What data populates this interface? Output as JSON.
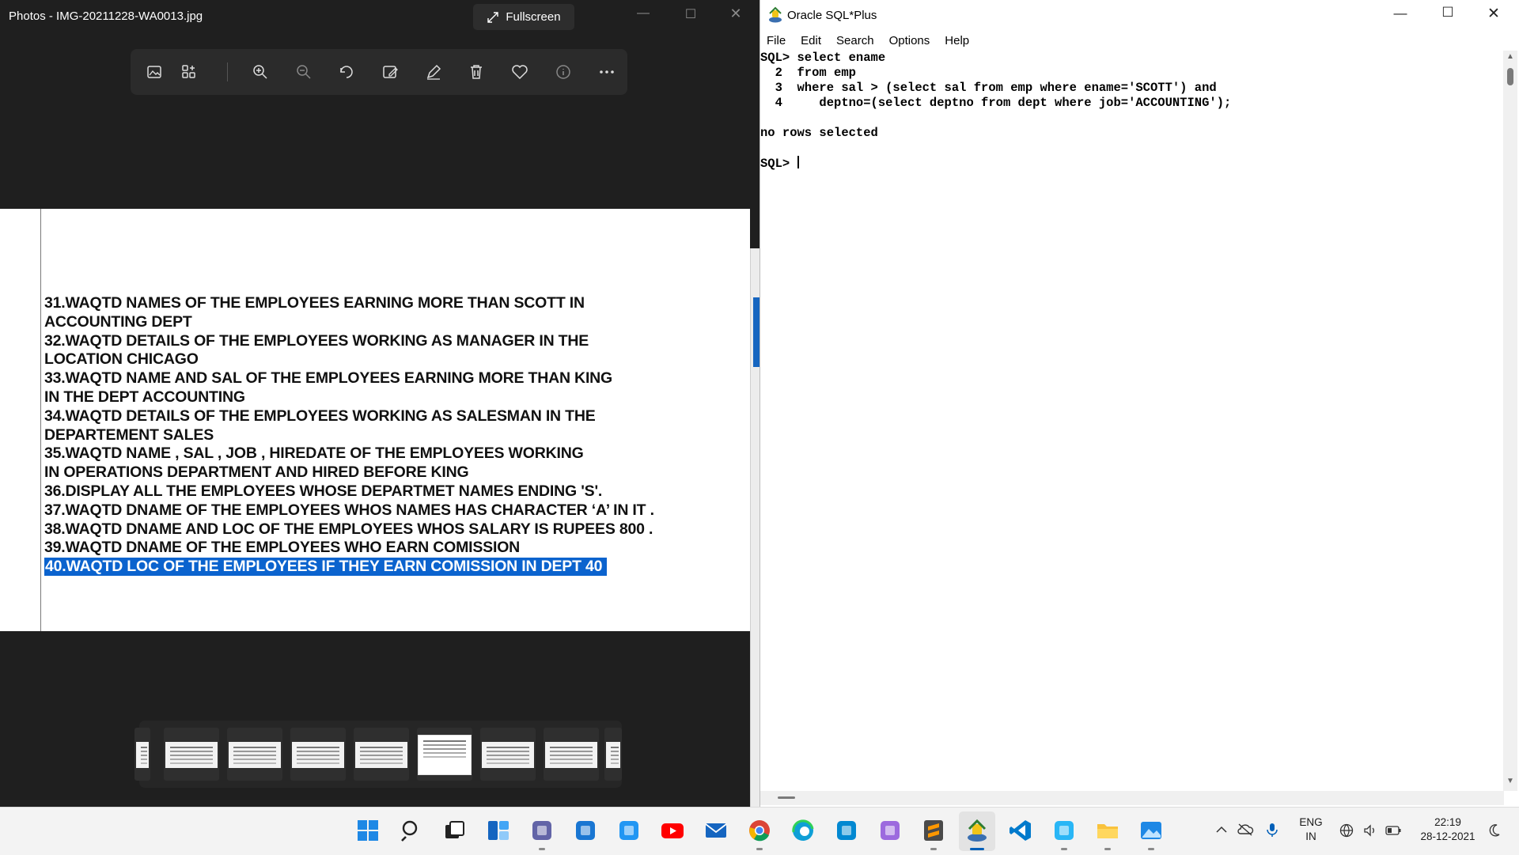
{
  "photos": {
    "title": "Photos - IMG-20211228-WA0013.jpg",
    "fullscreen_label": "Fullscreen",
    "toolbar_icons": [
      "image-icon",
      "album-icon",
      "zoom-in-icon",
      "zoom-out-icon",
      "rotate-icon",
      "edit-image-icon",
      "draw-icon",
      "delete-icon",
      "favorite-icon",
      "info-icon",
      "more-icon"
    ],
    "document_lines": [
      "31.WAQTD NAMES OF THE EMPLOYEES EARNING MORE THAN SCOTT IN",
      "ACCOUNTING DEPT",
      "32.WAQTD DETAILS OF THE EMPLOYEES WORKING AS MANAGER IN THE",
      "LOCATION CHICAGO",
      "33.WAQTD NAME AND SAL OF THE EMPLOYEES EARNING MORE THAN KING",
      " IN THE DEPT ACCOUNTING",
      "34.WAQTD DETAILS OF THE EMPLOYEES WORKING AS SALESMAN IN THE",
      "DEPARTEMENT SALES",
      "35.WAQTD NAME , SAL , JOB , HIREDATE OF THE EMPLOYEES WORKING",
      " IN OPERATIONS DEPARTMENT AND HIRED BEFORE KING",
      "36.DISPLAY ALL THE EMPLOYEES WHOSE DEPARTMET NAMES ENDING 'S'.",
      "37.WAQTD DNAME OF THE EMPLOYEES WHOS NAMES HAS CHARACTER ‘A’ IN IT .",
      "38.WAQTD DNAME AND LOC OF THE EMPLOYEES WHOS SALARY IS RUPEES 800 .",
      "39.WAQTD DNAME OF THE EMPLOYEES WHO EARN COMISSION",
      "40.WAQTD LOC OF THE EMPLOYEES IF THEY EARN COMISSION IN DEPT 40"
    ],
    "highlighted_line_index": 14
  },
  "sqlplus": {
    "title": "Oracle SQL*Plus",
    "menu": [
      "File",
      "Edit",
      "Search",
      "Options",
      "Help"
    ],
    "console_lines": [
      "SQL> select ename",
      "  2  from emp",
      "  3  where sal > (select sal from emp where ename='SCOTT') and",
      "  4     deptno=(select deptno from dept where job='ACCOUNTING');",
      "",
      "no rows selected",
      "",
      "SQL> "
    ]
  },
  "taskbar": {
    "apps": [
      "start-icon",
      "search-icon",
      "task-view-icon",
      "widgets-icon",
      "teams-chat-icon",
      "store-icon",
      "phone-icon",
      "youtube-icon",
      "mail-icon",
      "chrome-icon",
      "edge-icon",
      "remote-desktop-icon",
      "git-icon",
      "sublime-text-icon",
      "sqlplus-icon",
      "vscode-icon",
      "notepad-icon",
      "file-explorer-icon",
      "photos-icon"
    ],
    "language_top": "ENG",
    "language_bottom": "IN",
    "time": "22:19",
    "date": "28-12-2021"
  },
  "colors": {
    "highlight": "#0b63ce",
    "accent": "#005fb8",
    "dark_bg": "#1f1f1f"
  }
}
